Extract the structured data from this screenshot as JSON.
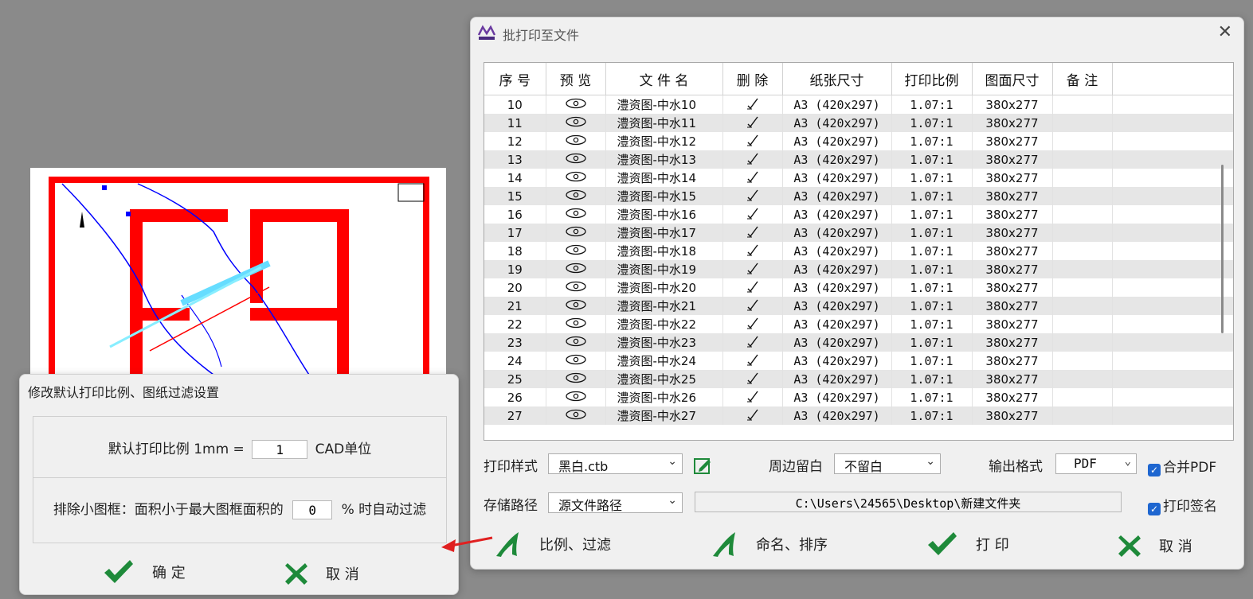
{
  "main_dialog": {
    "title": "批打印至文件",
    "columns": [
      "序 号",
      "预 览",
      "文 件 名",
      "删 除",
      "纸张尺寸",
      "打印比例",
      "图面尺寸",
      "备 注"
    ],
    "rows": [
      {
        "no": "10",
        "file": "澧资图-中水10",
        "paper": "A3 (420x297)",
        "scale": "1.07:1",
        "size": "380x277"
      },
      {
        "no": "11",
        "file": "澧资图-中水11",
        "paper": "A3 (420x297)",
        "scale": "1.07:1",
        "size": "380x277"
      },
      {
        "no": "12",
        "file": "澧资图-中水12",
        "paper": "A3 (420x297)",
        "scale": "1.07:1",
        "size": "380x277"
      },
      {
        "no": "13",
        "file": "澧资图-中水13",
        "paper": "A3 (420x297)",
        "scale": "1.07:1",
        "size": "380x277"
      },
      {
        "no": "14",
        "file": "澧资图-中水14",
        "paper": "A3 (420x297)",
        "scale": "1.07:1",
        "size": "380x277"
      },
      {
        "no": "15",
        "file": "澧资图-中水15",
        "paper": "A3 (420x297)",
        "scale": "1.07:1",
        "size": "380x277"
      },
      {
        "no": "16",
        "file": "澧资图-中水16",
        "paper": "A3 (420x297)",
        "scale": "1.07:1",
        "size": "380x277"
      },
      {
        "no": "17",
        "file": "澧资图-中水17",
        "paper": "A3 (420x297)",
        "scale": "1.07:1",
        "size": "380x277"
      },
      {
        "no": "18",
        "file": "澧资图-中水18",
        "paper": "A3 (420x297)",
        "scale": "1.07:1",
        "size": "380x277"
      },
      {
        "no": "19",
        "file": "澧资图-中水19",
        "paper": "A3 (420x297)",
        "scale": "1.07:1",
        "size": "380x277"
      },
      {
        "no": "20",
        "file": "澧资图-中水20",
        "paper": "A3 (420x297)",
        "scale": "1.07:1",
        "size": "380x277"
      },
      {
        "no": "21",
        "file": "澧资图-中水21",
        "paper": "A3 (420x297)",
        "scale": "1.07:1",
        "size": "380x277"
      },
      {
        "no": "22",
        "file": "澧资图-中水22",
        "paper": "A3 (420x297)",
        "scale": "1.07:1",
        "size": "380x277"
      },
      {
        "no": "23",
        "file": "澧资图-中水23",
        "paper": "A3 (420x297)",
        "scale": "1.07:1",
        "size": "380x277"
      },
      {
        "no": "24",
        "file": "澧资图-中水24",
        "paper": "A3 (420x297)",
        "scale": "1.07:1",
        "size": "380x277"
      },
      {
        "no": "25",
        "file": "澧资图-中水25",
        "paper": "A3 (420x297)",
        "scale": "1.07:1",
        "size": "380x277"
      },
      {
        "no": "26",
        "file": "澧资图-中水26",
        "paper": "A3 (420x297)",
        "scale": "1.07:1",
        "size": "380x277"
      },
      {
        "no": "27",
        "file": "澧资图-中水27",
        "paper": "A3 (420x297)",
        "scale": "1.07:1",
        "size": "380x277"
      }
    ],
    "print_style_label": "打印样式",
    "print_style_value": "黑白.ctb",
    "margin_label": "周边留白",
    "margin_value": "不留白",
    "output_format_label": "输出格式",
    "output_format_value": "PDF",
    "merge_pdf_label": "合并PDF",
    "save_path_label": "存储路径",
    "save_path_value": "源文件路径",
    "path_text": "C:\\Users\\24565\\Desktop\\新建文件夹",
    "print_signature_label": "打印签名",
    "btn_scale_filter": "比例、过滤",
    "btn_naming": "命名、排序",
    "btn_print": "打 印",
    "btn_cancel": "取 消"
  },
  "sub_dialog": {
    "title": "修改默认打印比例、图纸过滤设置",
    "scale_label": "默认打印比例 1mm =",
    "scale_value": "1",
    "scale_unit": "CAD单位",
    "filter_label": "排除小图框：面积小于最大图框面积的",
    "filter_value": "0",
    "filter_suffix": "% 时自动过滤",
    "ok_label": "确 定",
    "cancel_label": "取 消"
  },
  "colors": {
    "accent_green": "#1e8a3a",
    "checkbox_blue": "#1e66d0",
    "drawing_red": "#ff0000",
    "drawing_blue": "#0000ff"
  }
}
